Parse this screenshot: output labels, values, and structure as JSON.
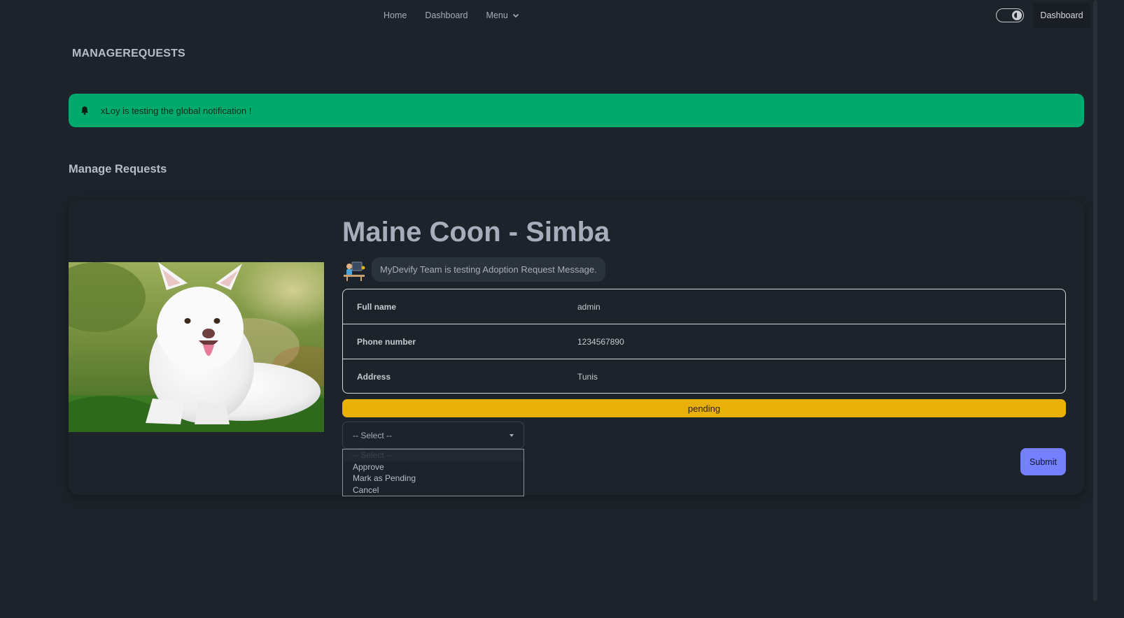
{
  "nav": {
    "links": [
      "Home",
      "Dashboard",
      "Menu"
    ],
    "right_button": "Dashboard"
  },
  "brand": "MANAGEREQUESTS",
  "notification": {
    "icon": "bell-icon",
    "text": "xLoy is testing the global notification !",
    "color": "#00a96e"
  },
  "section_title": "Manage Requests",
  "request": {
    "title": "Maine Coon - Simba",
    "message": "MyDevify Team is testing Adoption Request Message.",
    "fields": [
      {
        "label": "Full name",
        "value": "admin"
      },
      {
        "label": "Phone number",
        "value": "1234567890"
      },
      {
        "label": "Address",
        "value": "Tunis"
      }
    ],
    "status": "pending",
    "status_color": "#e8b008"
  },
  "select": {
    "value": "-- Select --",
    "options": [
      "-- Select --",
      "Approve",
      "Mark as Pending",
      "Cancel"
    ]
  },
  "submit_label": "Submit",
  "accent_color": "#7480ff"
}
